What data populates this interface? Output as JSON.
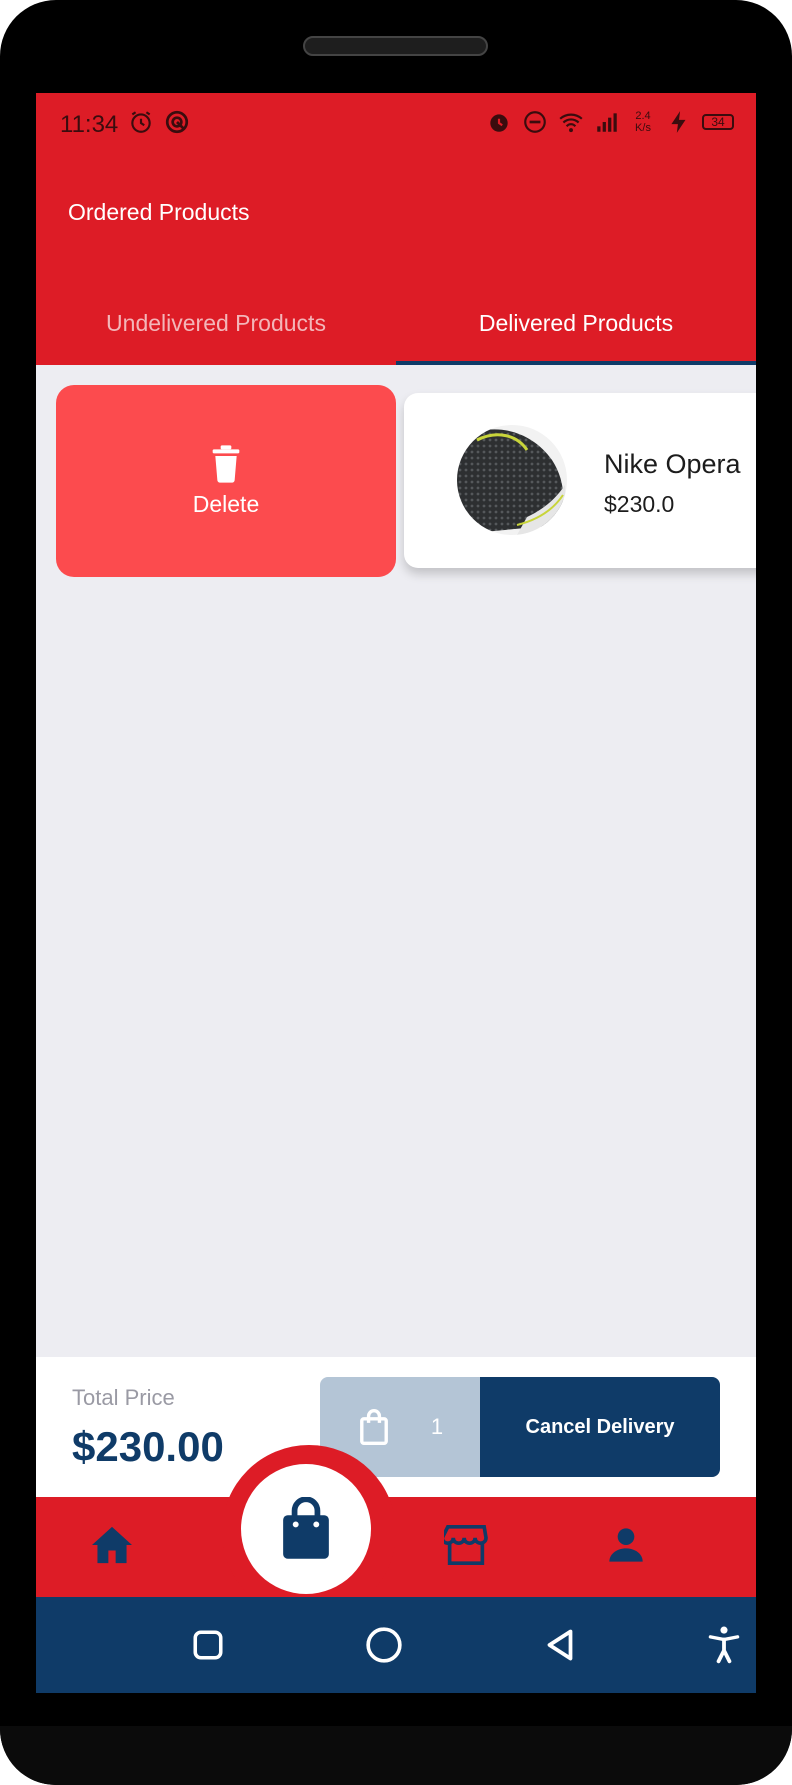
{
  "status_bar": {
    "time": "11:34",
    "network_speed": "2.4 K/s",
    "battery": "34",
    "left_icons": [
      "alarm-icon",
      "sync-icon"
    ],
    "right_icons": [
      "alarm-icon",
      "do-not-disturb-icon",
      "wifi-icon",
      "signal-icon",
      "charging-icon",
      "battery-icon"
    ]
  },
  "appbar": {
    "title": "Ordered Products"
  },
  "tabs": [
    {
      "label": "Undelivered Products",
      "active": false
    },
    {
      "label": "Delivered Products",
      "active": true
    }
  ],
  "order_item": {
    "delete_label": "Delete",
    "name": "Nike Opera",
    "price": "$230.0",
    "image_icon": "sneaker-image"
  },
  "checkout": {
    "total_label": "Total Price",
    "total_value": "$230.00",
    "item_count": "1",
    "cancel_label": "Cancel Delivery"
  },
  "bottom_nav": {
    "items": [
      "home-icon",
      "shopping-bag-icon",
      "store-icon",
      "person-icon"
    ],
    "active": "shopping-bag-icon"
  },
  "colors": {
    "primary_red": "#dd1c26",
    "navy": "#0f3b68",
    "delete_red": "#fc4b4e",
    "background": "#ededf2"
  }
}
